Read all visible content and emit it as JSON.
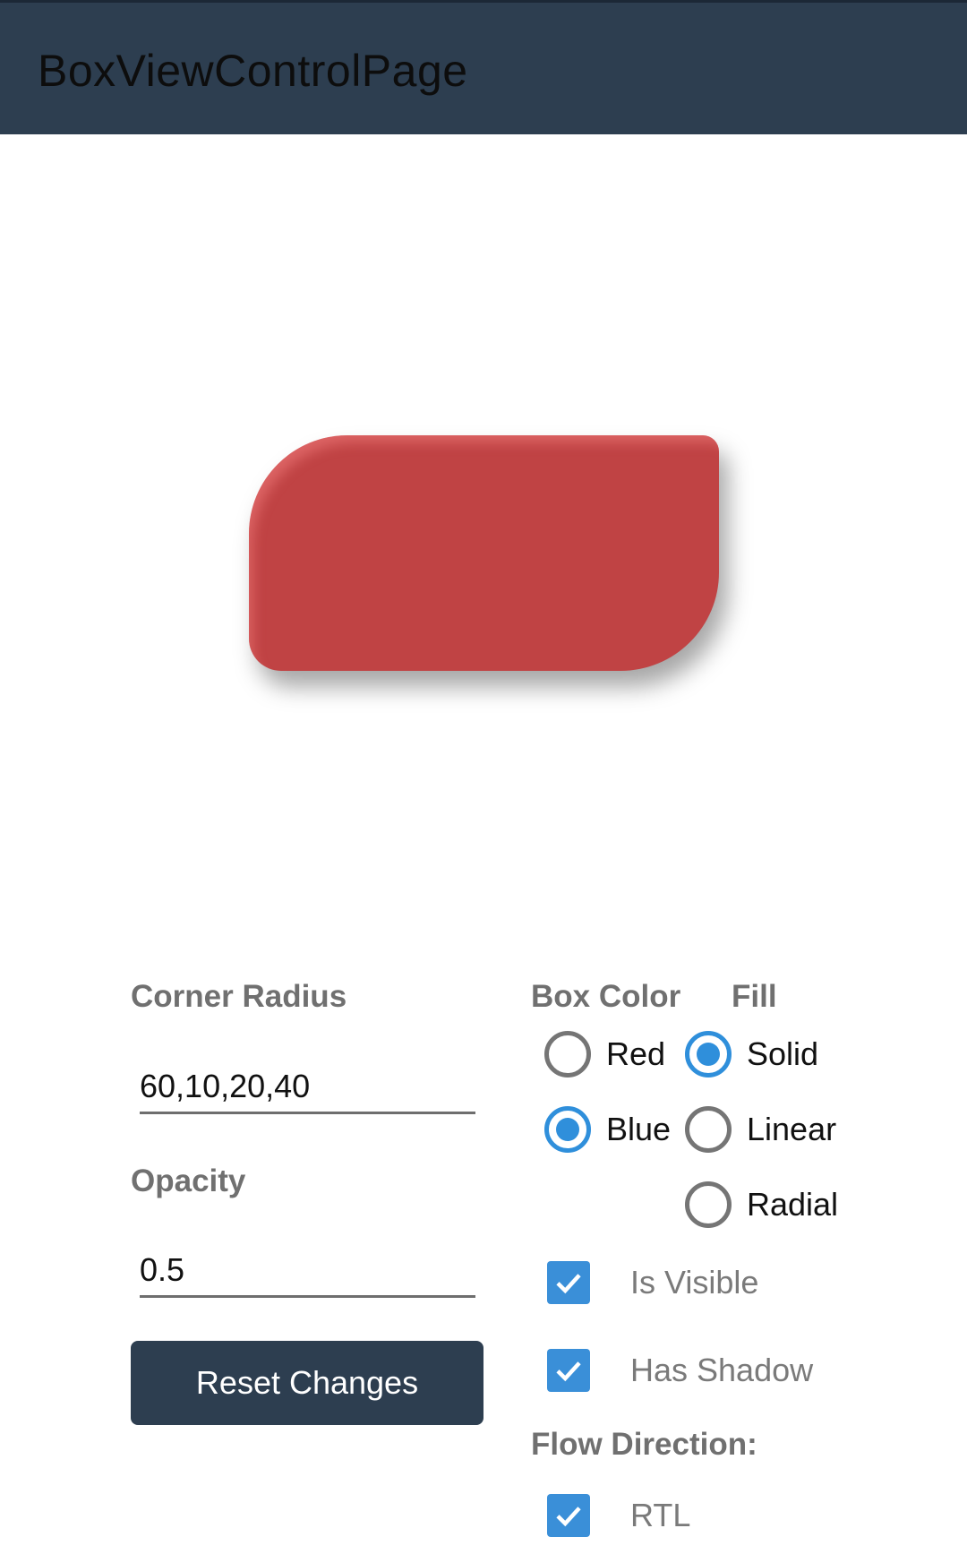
{
  "app_bar": {
    "title": "BoxViewControlPage"
  },
  "preview": {
    "box_color": "#c04344"
  },
  "corner_radius": {
    "label": "Corner Radius",
    "value": "60,10,20,40"
  },
  "opacity": {
    "label": "Opacity",
    "value": "0.5"
  },
  "reset_button": {
    "label": "Reset Changes"
  },
  "box_color": {
    "label": "Box Color",
    "options": [
      {
        "label": "Red",
        "selected": false
      },
      {
        "label": "Blue",
        "selected": true
      }
    ]
  },
  "fill": {
    "label": "Fill",
    "options": [
      {
        "label": "Solid",
        "selected": true
      },
      {
        "label": "Linear",
        "selected": false
      },
      {
        "label": "Radial",
        "selected": false
      }
    ]
  },
  "is_visible": {
    "label": "Is Visible",
    "checked": true
  },
  "has_shadow": {
    "label": "Has Shadow",
    "checked": true
  },
  "flow_direction": {
    "label": "Flow Direction:",
    "rtl_label": "RTL",
    "rtl_checked": true
  },
  "colors": {
    "app_bar": "#2d3e50",
    "accent": "#2f8fdb",
    "checkbox": "#3a8fd8"
  }
}
